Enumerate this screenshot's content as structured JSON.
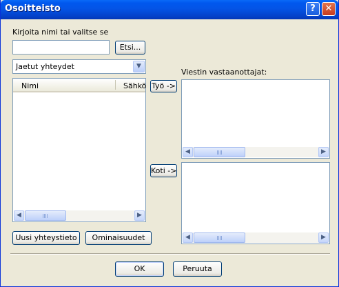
{
  "window": {
    "title": "Osoitteisto"
  },
  "search": {
    "label": "Kirjoita nimi tai valitse se",
    "value": "",
    "find_button": "Etsi..."
  },
  "source_select": {
    "selected": "Jaetut yhteydet"
  },
  "contacts_list": {
    "columns": [
      "Nimi",
      "Sähkö"
    ],
    "rows": []
  },
  "recipients": {
    "label": "Viestin vastaanottajat:",
    "work_button": "Työ ->",
    "home_button": "Koti ->"
  },
  "actions": {
    "new_contact": "Uusi yhteystieto",
    "properties": "Ominaisuudet"
  },
  "footer": {
    "ok": "OK",
    "cancel": "Peruuta"
  },
  "icons": {
    "help": "question-mark",
    "close": "x"
  }
}
